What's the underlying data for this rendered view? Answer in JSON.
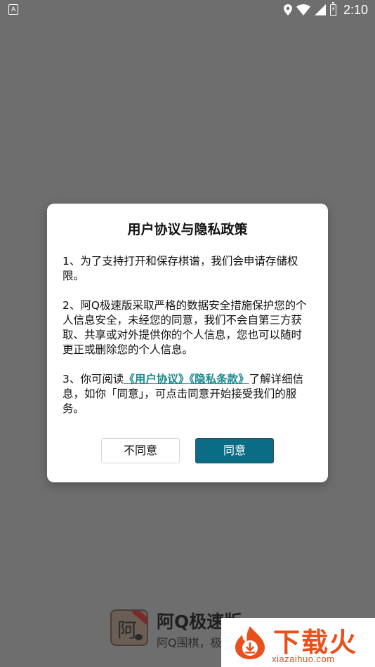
{
  "status_bar": {
    "left_icon_letter": "A",
    "time": "2:10",
    "icons": [
      "notification-a-icon",
      "location-icon",
      "wifi-icon",
      "signal-icon",
      "battery-charging-icon"
    ]
  },
  "dialog": {
    "title": "用户协议与隐私政策",
    "paragraph1": "1、为了支持打开和保存棋谱，我们会申请存储权限。",
    "paragraph2": "2、阿Q极速版采取严格的数据安全措施保护您的个人信息安全，未经您的同意，我们不会自第三方获取、共享或对外提供你的个人信息，您也可以随时更正或删除您的个人信息。",
    "paragraph3_prefix": "3、你可阅读",
    "link_user_agreement": "《用户协议》",
    "link_privacy_terms": "《隐私条款》",
    "paragraph3_suffix": "了解详细信息，如你「同意」，可点击同意开始接受我们的服务。",
    "disagree_label": "不同意",
    "agree_label": "同意"
  },
  "app_banner": {
    "icon_char": "阿",
    "name": "阿Q极速版",
    "subtitle": "阿Q围棋，",
    "subtitle_partial": "极"
  },
  "watermark": {
    "title": "下载火",
    "url": "xiazaihuo.com"
  },
  "colors": {
    "overlay": "#6e6e6e",
    "agree_button": "#0b6c86",
    "link": "#1a8a8c",
    "watermark": "#e8501c"
  }
}
